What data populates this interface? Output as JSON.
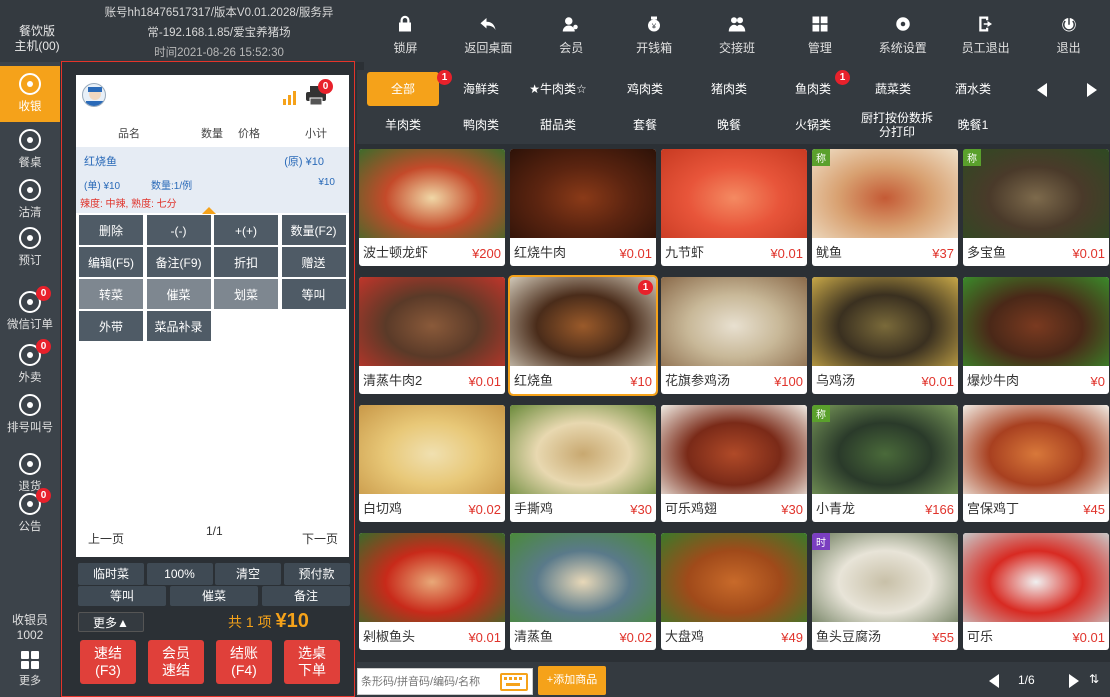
{
  "header": {
    "app_label": "餐饮版\n主机(00)",
    "info_line1": "账号hh18476517317/版本V0.01.2028/服务异",
    "info_line2": "常-192.168.1.85/爱宝养猪场",
    "info_line3": "时间2021-08-26 15:52:30"
  },
  "topnav": [
    {
      "label": "锁屏",
      "icon": "lock-icon"
    },
    {
      "label": "返回桌面",
      "icon": "back-arrow-icon"
    },
    {
      "label": "会员",
      "icon": "member-icon"
    },
    {
      "label": "开钱箱",
      "icon": "cash-box-icon"
    },
    {
      "label": "交接班",
      "icon": "shift-handover-icon"
    },
    {
      "label": "管理",
      "icon": "manage-icon"
    },
    {
      "label": "系统设置",
      "icon": "settings-gear-icon"
    },
    {
      "label": "员工退出",
      "icon": "staff-logout-icon"
    },
    {
      "label": "退出",
      "icon": "power-icon"
    }
  ],
  "sidebar": {
    "items": [
      {
        "label": "收银",
        "icon": "cashier-icon"
      },
      {
        "label": "餐桌",
        "icon": "dining-table-icon"
      },
      {
        "label": "沽清",
        "icon": "warning-icon"
      },
      {
        "label": "预订",
        "icon": "reservation-icon"
      },
      {
        "label": "微信订单",
        "icon": "wechat-icon",
        "badge": "0"
      },
      {
        "label": "外卖",
        "icon": "takeout-icon",
        "badge": "0"
      },
      {
        "label": "排号叫号",
        "icon": "queue-icon"
      },
      {
        "label": "退货",
        "icon": "return-icon"
      },
      {
        "label": "公告",
        "icon": "notice-icon",
        "badge": "0"
      }
    ],
    "cashier_label": "收银员",
    "cashier_id": "1002",
    "more_label": "更多"
  },
  "order": {
    "print_badge": "0",
    "headers": {
      "name": "品名",
      "qty": "数量",
      "price": "价格",
      "subtotal": "小计"
    },
    "item": {
      "name": "红烧鱼",
      "orig_price": "(原) ¥10",
      "unit_price": "(单) ¥10",
      "qty": "数量:1/例",
      "subtotal": "¥10",
      "options": "辣度: 中辣, 熟度: 七分"
    },
    "actions": [
      [
        "删除",
        "-(-)",
        "+(+)",
        "数量(F2)"
      ],
      [
        "编辑(F5)",
        "备注(F9)",
        "折扣",
        "赠送"
      ],
      [
        "转菜",
        "催菜",
        "划菜",
        "等叫"
      ],
      [
        "外带",
        "菜品补录"
      ]
    ],
    "prev_page": "上一页",
    "page": "1/1",
    "next_page": "下一页"
  },
  "ops": {
    "row1": [
      "临时菜",
      "100%",
      "清空",
      "预付款"
    ],
    "row2": [
      "等叫",
      "催菜",
      "备注"
    ],
    "more": "更多▲",
    "total_prefix": "共",
    "total_count": "1",
    "total_unit": "项",
    "total_amount": "¥10"
  },
  "big_buttons": [
    {
      "line1": "速结",
      "line2": "(F3)"
    },
    {
      "line1": "会员",
      "line2": "速结"
    },
    {
      "line1": "结账",
      "line2": "(F4)"
    },
    {
      "line1": "选桌",
      "line2": "下单"
    }
  ],
  "categories": {
    "row1": [
      {
        "label": "全部",
        "badge": "1"
      },
      {
        "label": "海鲜类"
      },
      {
        "label": "★牛肉类☆"
      },
      {
        "label": "鸡肉类"
      },
      {
        "label": "猪肉类"
      },
      {
        "label": "鱼肉类",
        "badge": "1"
      },
      {
        "label": "蔬菜类"
      },
      {
        "label": "酒水类"
      }
    ],
    "row2": [
      "羊肉类",
      "鸭肉类",
      "甜品类",
      "套餐",
      "晚餐",
      "火锅类",
      "厨打按份数拆分打印",
      "晚餐1"
    ]
  },
  "dishes": [
    {
      "name": "波士顿龙虾",
      "price": "¥200",
      "c1": "#c44a2a",
      "c2": "#f0d7a6",
      "c3": "#3d6b2b"
    },
    {
      "name": "红烧牛肉",
      "price": "¥0.01",
      "c1": "#5b2410",
      "c2": "#8a3a18",
      "c3": "#2d1208"
    },
    {
      "name": "九节虾",
      "price": "¥0.01",
      "c1": "#e8553a",
      "c2": "#f48a62",
      "c3": "#c73a22"
    },
    {
      "name": "鱿鱼",
      "price": "¥37",
      "tag": "称",
      "c1": "#d8a070",
      "c2": "#c45a35",
      "c3": "#efe0c8"
    },
    {
      "name": "多宝鱼",
      "price": "¥0.01",
      "tag": "称",
      "c1": "#4a3a2a",
      "c2": "#7d6a4c",
      "c3": "#2e4a22"
    },
    {
      "name": "清蒸牛肉2",
      "price": "¥0.01",
      "c1": "#5a3a28",
      "c2": "#8a5a3a",
      "c3": "#c0352a"
    },
    {
      "name": "红烧鱼",
      "price": "¥10",
      "badge": "1",
      "sel": true,
      "c1": "#4a2c1a",
      "c2": "#9a5a2a",
      "c3": "#d0c8b8"
    },
    {
      "name": "花旗参鸡汤",
      "price": "¥100",
      "c1": "#c8b898",
      "c2": "#e8e0d0",
      "c3": "#8a6a4a"
    },
    {
      "name": "乌鸡汤",
      "price": "¥0.01",
      "c1": "#3a3020",
      "c2": "#7a6a3a",
      "c3": "#c8a848"
    },
    {
      "name": "爆炒牛肉",
      "price": "¥0",
      "c1": "#4a2818",
      "c2": "#7a3a20",
      "c3": "#3a8a2a"
    },
    {
      "name": "白切鸡",
      "price": "¥0.02",
      "c1": "#e8c878",
      "c2": "#f0e0b0",
      "c3": "#c89848"
    },
    {
      "name": "手撕鸡",
      "price": "¥30",
      "c1": "#e8d8b0",
      "c2": "#c8a870",
      "c3": "#6a8a3a"
    },
    {
      "name": "可乐鸡翅",
      "price": "¥30",
      "c1": "#7a2a18",
      "c2": "#b04a28",
      "c3": "#f0ece4"
    },
    {
      "name": "小青龙",
      "price": "¥166",
      "tag": "称",
      "c1": "#2a3a2a",
      "c2": "#4a6a3a",
      "c3": "#7a9a5a"
    },
    {
      "name": "宫保鸡丁",
      "price": "¥45",
      "c1": "#a84020",
      "c2": "#d8783a",
      "c3": "#f0ece4"
    },
    {
      "name": "剁椒鱼头",
      "price": "¥0.01",
      "c1": "#c82a1a",
      "c2": "#e8a878",
      "c3": "#3a6a2a"
    },
    {
      "name": "清蒸鱼",
      "price": "¥0.02",
      "c1": "#5a7a8a",
      "c2": "#e8d8b8",
      "c3": "#4a8a3a"
    },
    {
      "name": "大盘鸡",
      "price": "¥49",
      "c1": "#a04a1a",
      "c2": "#c86a2a",
      "c3": "#3a7a2a"
    },
    {
      "name": "鱼头豆腐汤",
      "price": "¥55",
      "tag": "时",
      "tagc": "purple",
      "c1": "#e8e4d8",
      "c2": "#c8c0a8",
      "c3": "#6a7a5a"
    },
    {
      "name": "可乐",
      "price": "¥0.01",
      "c1": "#d82a22",
      "c2": "#f0f0f0",
      "c3": "#c8c8c8"
    }
  ],
  "bottom": {
    "search_placeholder": "条形码/拼音码/编码/名称",
    "add_label": "+添加商品",
    "page": "1/6"
  },
  "colors": {
    "accent": "#f5a21a",
    "danger": "#e0403a",
    "dark": "#343a40"
  }
}
